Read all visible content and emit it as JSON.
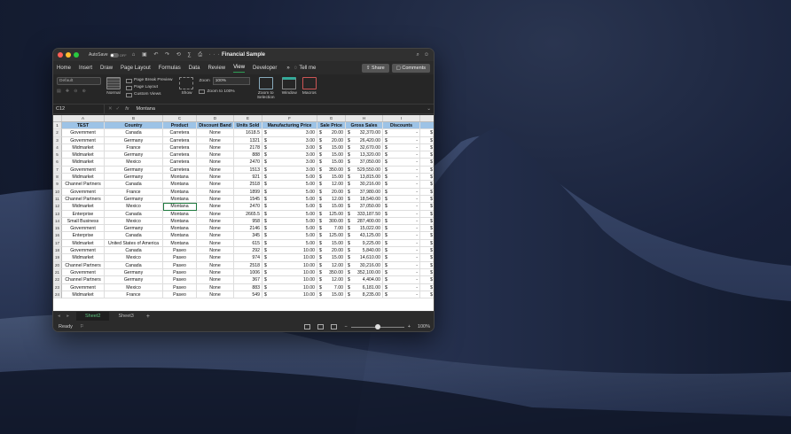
{
  "window": {
    "autosave_label": "AutoSave",
    "autosave_state": "OFF",
    "doc_title": "Financial Sample",
    "quick_access": "⌂ ▣ ↶ ↷ ⟲ ∑ ⎙ ···"
  },
  "menu": {
    "items": [
      "Home",
      "Insert",
      "Draw",
      "Page Layout",
      "Formulas",
      "Data",
      "Review",
      "View",
      "Developer"
    ],
    "active": "View",
    "more": "»",
    "tell_me": "Tell me",
    "share": "Share",
    "comments": "Comments"
  },
  "ribbon": {
    "default_dropdown": "Default",
    "normal": "Normal",
    "page_break_preview": "Page Break Preview",
    "page_layout": "Page Layout",
    "custom_views": "Custom Views",
    "show": "Show",
    "zoom_label": "Zoom",
    "zoom_value": "100%",
    "zoom_to_100": "Zoom to 100%",
    "zoom_to_selection": "Zoom to Selection",
    "window": "Window",
    "macros": "Macros"
  },
  "formula_bar": {
    "name_box": "C12",
    "fx": "fx",
    "content": "Montana"
  },
  "columns": [
    "A",
    "B",
    "C",
    "D",
    "E",
    "F",
    "G",
    "H",
    "I",
    ""
  ],
  "header_row": [
    "TEST",
    "Country",
    "Product",
    "Discount Band",
    "Units Sold",
    "Manufacturing Price",
    "Sale Price",
    "Gross Sales",
    "Discounts",
    ""
  ],
  "rows": [
    [
      "Government",
      "Canada",
      "Carretera",
      "None",
      "1618.5",
      "$",
      "3.00",
      "$",
      "20.00",
      "$",
      "32,370.00",
      "$",
      "-",
      "$"
    ],
    [
      "Government",
      "Germany",
      "Carretera",
      "None",
      "1321",
      "$",
      "3.00",
      "$",
      "20.00",
      "$",
      "26,420.00",
      "$",
      "-",
      "$"
    ],
    [
      "Midmarket",
      "France",
      "Carretera",
      "None",
      "2178",
      "$",
      "3.00",
      "$",
      "15.00",
      "$",
      "32,670.00",
      "$",
      "-",
      "$"
    ],
    [
      "Midmarket",
      "Germany",
      "Carretera",
      "None",
      "888",
      "$",
      "3.00",
      "$",
      "15.00",
      "$",
      "13,320.00",
      "$",
      "-",
      "$"
    ],
    [
      "Midmarket",
      "Mexico",
      "Carretera",
      "None",
      "2470",
      "$",
      "3.00",
      "$",
      "15.00",
      "$",
      "37,050.00",
      "$",
      "-",
      "$"
    ],
    [
      "Government",
      "Germany",
      "Carretera",
      "None",
      "1513",
      "$",
      "3.00",
      "$",
      "350.00",
      "$",
      "529,550.00",
      "$",
      "-",
      "$"
    ],
    [
      "Midmarket",
      "Germany",
      "Montana",
      "None",
      "921",
      "$",
      "5.00",
      "$",
      "15.00",
      "$",
      "13,815.00",
      "$",
      "-",
      "$"
    ],
    [
      "Channel Partners",
      "Canada",
      "Montana",
      "None",
      "2518",
      "$",
      "5.00",
      "$",
      "12.00",
      "$",
      "30,216.00",
      "$",
      "-",
      "$"
    ],
    [
      "Government",
      "France",
      "Montana",
      "None",
      "1899",
      "$",
      "5.00",
      "$",
      "20.00",
      "$",
      "37,980.00",
      "$",
      "-",
      "$"
    ],
    [
      "Channel Partners",
      "Germany",
      "Montana",
      "None",
      "1545",
      "$",
      "5.00",
      "$",
      "12.00",
      "$",
      "18,540.00",
      "$",
      "-",
      "$"
    ],
    [
      "Midmarket",
      "Mexico",
      "Montana",
      "None",
      "2470",
      "$",
      "5.00",
      "$",
      "15.00",
      "$",
      "37,050.00",
      "$",
      "-",
      "$"
    ],
    [
      "Enterprise",
      "Canada",
      "Montana",
      "None",
      "2665.5",
      "$",
      "5.00",
      "$",
      "125.00",
      "$",
      "333,187.50",
      "$",
      "-",
      "$"
    ],
    [
      "Small Business",
      "Mexico",
      "Montana",
      "None",
      "958",
      "$",
      "5.00",
      "$",
      "300.00",
      "$",
      "287,400.00",
      "$",
      "-",
      "$"
    ],
    [
      "Government",
      "Germany",
      "Montana",
      "None",
      "2146",
      "$",
      "5.00",
      "$",
      "7.00",
      "$",
      "15,022.00",
      "$",
      "-",
      "$"
    ],
    [
      "Enterprise",
      "Canada",
      "Montana",
      "None",
      "345",
      "$",
      "5.00",
      "$",
      "125.00",
      "$",
      "43,125.00",
      "$",
      "-",
      "$"
    ],
    [
      "Midmarket",
      "United States of America",
      "Montana",
      "None",
      "615",
      "$",
      "5.00",
      "$",
      "15.00",
      "$",
      "9,225.00",
      "$",
      "-",
      "$"
    ],
    [
      "Government",
      "Canada",
      "Paseo",
      "None",
      "292",
      "$",
      "10.00",
      "$",
      "20.00",
      "$",
      "5,840.00",
      "$",
      "-",
      "$"
    ],
    [
      "Midmarket",
      "Mexico",
      "Paseo",
      "None",
      "974",
      "$",
      "10.00",
      "$",
      "15.00",
      "$",
      "14,610.00",
      "$",
      "-",
      "$"
    ],
    [
      "Channel Partners",
      "Canada",
      "Paseo",
      "None",
      "2518",
      "$",
      "10.00",
      "$",
      "12.00",
      "$",
      "30,216.00",
      "$",
      "-",
      "$"
    ],
    [
      "Government",
      "Germany",
      "Paseo",
      "None",
      "1006",
      "$",
      "10.00",
      "$",
      "350.00",
      "$",
      "352,100.00",
      "$",
      "-",
      "$"
    ],
    [
      "Channel Partners",
      "Germany",
      "Paseo",
      "None",
      "367",
      "$",
      "10.00",
      "$",
      "12.00",
      "$",
      "4,404.00",
      "$",
      "-",
      "$"
    ],
    [
      "Government",
      "Mexico",
      "Paseo",
      "None",
      "883",
      "$",
      "10.00",
      "$",
      "7.00",
      "$",
      "6,181.00",
      "$",
      "-",
      "$"
    ],
    [
      "Midmarket",
      "France",
      "Paseo",
      "None",
      "549",
      "$",
      "10.00",
      "$",
      "15.00",
      "$",
      "8,235.00",
      "$",
      "-",
      "$"
    ]
  ],
  "sheets": [
    "Sheet2",
    "Sheet3"
  ],
  "active_sheet": "Sheet2",
  "status": {
    "ready": "Ready",
    "zoom": "100%",
    "zoom_fraction": 0.5
  }
}
